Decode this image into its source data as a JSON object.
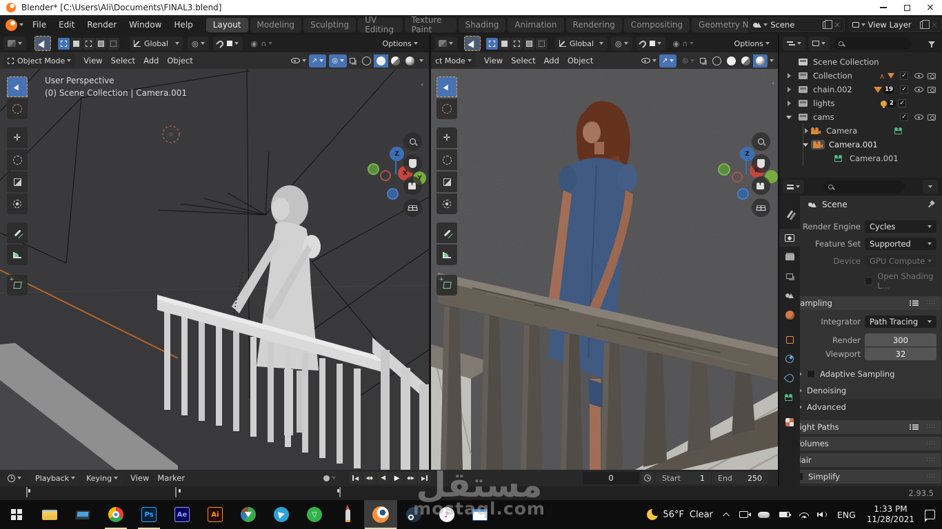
{
  "titlebar": {
    "title": "Blender* [C:\\Users\\Ali\\Documents\\FINAL3.blend]"
  },
  "topbar": {
    "menus": [
      "File",
      "Edit",
      "Render",
      "Window",
      "Help"
    ],
    "tabs": [
      "Layout",
      "Modeling",
      "Sculpting",
      "UV Editing",
      "Texture Paint",
      "Shading",
      "Animation",
      "Rendering",
      "Compositing",
      "Geometry Nod"
    ],
    "active_tab": "Layout",
    "scene_value": "Scene",
    "view_layer_value": "View Layer"
  },
  "tool_settings": {
    "orientation": "Global",
    "options_label": "Options"
  },
  "viewport": {
    "menus": [
      "View",
      "Select",
      "Add",
      "Object"
    ],
    "left": {
      "mode": "Object Mode",
      "overlay_line1": "User Perspective",
      "overlay_line2": "(0) Scene Collection | Camera.001"
    },
    "right": {
      "mode": "ct Mode"
    },
    "axis": {
      "x": "X",
      "y": "Y",
      "z": "Z"
    }
  },
  "outliner": {
    "root": "Scene Collection",
    "collection": "Collection",
    "chain": "chain.002",
    "chain_badge": "19",
    "lights": "lights",
    "lights_badge": "2",
    "cams": "cams",
    "camera": "Camera",
    "camera001": "Camera.001",
    "camera001_data": "Camera.001"
  },
  "properties": {
    "breadcrumb": "Scene",
    "render_engine_label": "Render Engine",
    "render_engine_value": "Cycles",
    "feature_set_label": "Feature Set",
    "feature_set_value": "Supported",
    "device_label": "Device",
    "device_value": "GPU Compute",
    "osl_label": "Open Shading L...",
    "sampling_title": "Sampling",
    "integrator_label": "Integrator",
    "integrator_value": "Path Tracing",
    "render_label": "Render",
    "render_value": "300",
    "viewport_label": "Viewport",
    "viewport_value": "32",
    "adaptive_label": "Adaptive Sampling",
    "denoising_label": "Denoising",
    "advanced_label": "Advanced",
    "light_paths_label": "Light Paths",
    "volumes_label": "Volumes",
    "hair_label": "Hair",
    "simplify_label": "Simplify"
  },
  "timeline": {
    "playback": "Playback",
    "keying": "Keying",
    "view": "View",
    "marker": "Marker",
    "current_frame": "0",
    "start_label": "Start",
    "start_value": "1",
    "end_label": "End",
    "end_value": "250"
  },
  "statusbar": {
    "version": "2.93.5"
  },
  "taskbar": {
    "photoshop_label": "Ps",
    "after_effects_label": "Ae",
    "illustrator_label": "Ai",
    "tray": {
      "temp": "56°F",
      "condition": "Clear",
      "lang": "ENG",
      "time": "1:33 PM",
      "date": "11/28/2021"
    }
  },
  "watermark": {
    "arabic": "مستقل",
    "latin": "mostaql.com"
  },
  "colors": {
    "accent_blue": "#4772b3",
    "blender_orange": "#e87d0d",
    "titlebar_bg": "#ffffff",
    "editor_dark": "#1d1d1d",
    "viewport_bg": "#3a3a3c",
    "render_sky": "#5a595b"
  }
}
